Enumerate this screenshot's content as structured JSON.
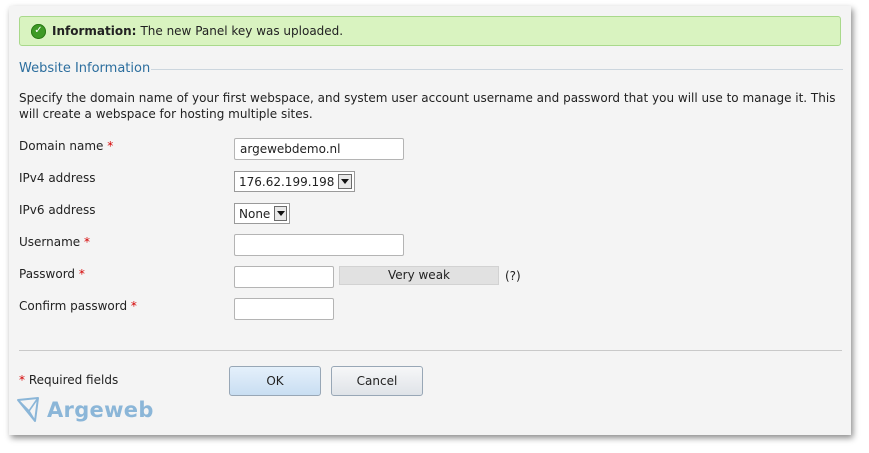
{
  "message": {
    "label": "Information:",
    "text": "The new Panel key was uploaded.",
    "icon": "check-icon"
  },
  "section": {
    "title": "Website Information",
    "description": "Specify the domain name of your first webspace, and system user account username and password that you will use to manage it. This will create a webspace for hosting multiple sites."
  },
  "form": {
    "domain": {
      "label": "Domain name",
      "required_mark": "*",
      "value": "argewebdemo.nl"
    },
    "ipv4": {
      "label": "IPv4 address",
      "selected": "176.62.199.198"
    },
    "ipv6": {
      "label": "IPv6 address",
      "selected": "None"
    },
    "username": {
      "label": "Username",
      "required_mark": "*",
      "value": ""
    },
    "password": {
      "label": "Password",
      "required_mark": "*",
      "value": "",
      "strength": "Very weak",
      "hint": "(?)"
    },
    "confirm": {
      "label": "Confirm password",
      "required_mark": "*",
      "value": ""
    }
  },
  "footer": {
    "required_mark": "*",
    "required_text": "Required fields",
    "ok_label": "OK",
    "cancel_label": "Cancel"
  },
  "logo": {
    "text": "Argeweb",
    "icon": "argeweb-logo-icon",
    "color": "#8bb6d8"
  },
  "colors": {
    "title": "#2c6e9e",
    "success_bg": "#d9f3c0",
    "required": "#d40000"
  }
}
